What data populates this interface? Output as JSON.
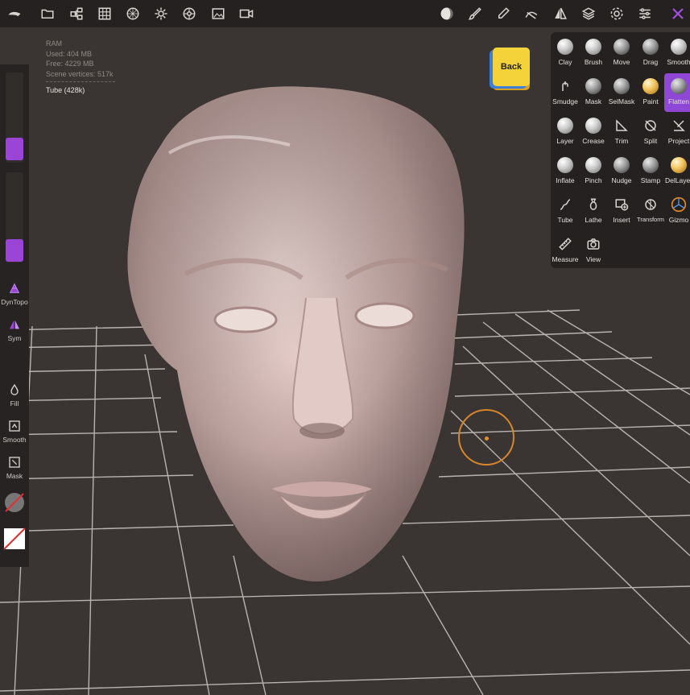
{
  "toolbar": {
    "icons": [
      "logo-icon",
      "folder-icon",
      "scene-tree-icon",
      "grid-icon",
      "topology-icon",
      "lighting-icon",
      "settings-wheel-icon",
      "image-icon",
      "video-icon",
      "matcap-icon",
      "brush-stroke-icon",
      "picker-icon",
      "stroke-settings-icon",
      "symmetry-icon",
      "layers-icon",
      "gear-icon",
      "sliders-icon",
      "tools-icon"
    ]
  },
  "info": {
    "ram_label": "RAM",
    "used": "Used: 404 MB",
    "free": "Free: 4229 MB",
    "vertices": "Scene vertices: 517k",
    "object": "Tube (428k)"
  },
  "back_cube": {
    "label": "Back"
  },
  "left_panel": {
    "sliders": [
      {
        "level": 0.15
      },
      {
        "level": 0.08
      }
    ],
    "items": [
      {
        "label": "DynTopo",
        "icon": "dyntopo-icon"
      },
      {
        "label": "Sym",
        "icon": "symmetry-icon"
      },
      {
        "label": "Fill",
        "icon": "fill-drop-icon"
      },
      {
        "label": "Smooth",
        "icon": "smooth-icon"
      },
      {
        "label": "Mask",
        "icon": "mask-icon"
      }
    ]
  },
  "tools": [
    {
      "label": "Clay"
    },
    {
      "label": "Brush"
    },
    {
      "label": "Move"
    },
    {
      "label": "Drag"
    },
    {
      "label": "Smooth"
    },
    {
      "label": "Smudge"
    },
    {
      "label": "Mask"
    },
    {
      "label": "SelMask"
    },
    {
      "label": "Paint"
    },
    {
      "label": "Flatten"
    },
    {
      "label": "Layer"
    },
    {
      "label": "Crease"
    },
    {
      "label": "Trim"
    },
    {
      "label": "Split"
    },
    {
      "label": "Project"
    },
    {
      "label": "Inflate"
    },
    {
      "label": "Pinch"
    },
    {
      "label": "Nudge"
    },
    {
      "label": "Stamp"
    },
    {
      "label": "DelLayer"
    },
    {
      "label": "Tube"
    },
    {
      "label": "Lathe"
    },
    {
      "label": "Insert"
    },
    {
      "label": "Transform"
    },
    {
      "label": "Gizmo"
    },
    {
      "label": "Measure"
    },
    {
      "label": "View"
    }
  ],
  "active_tool": "Flatten",
  "colors": {
    "accent": "#9b45d6",
    "cursor": "#d7862a",
    "back_cube": "#f4d33a"
  }
}
